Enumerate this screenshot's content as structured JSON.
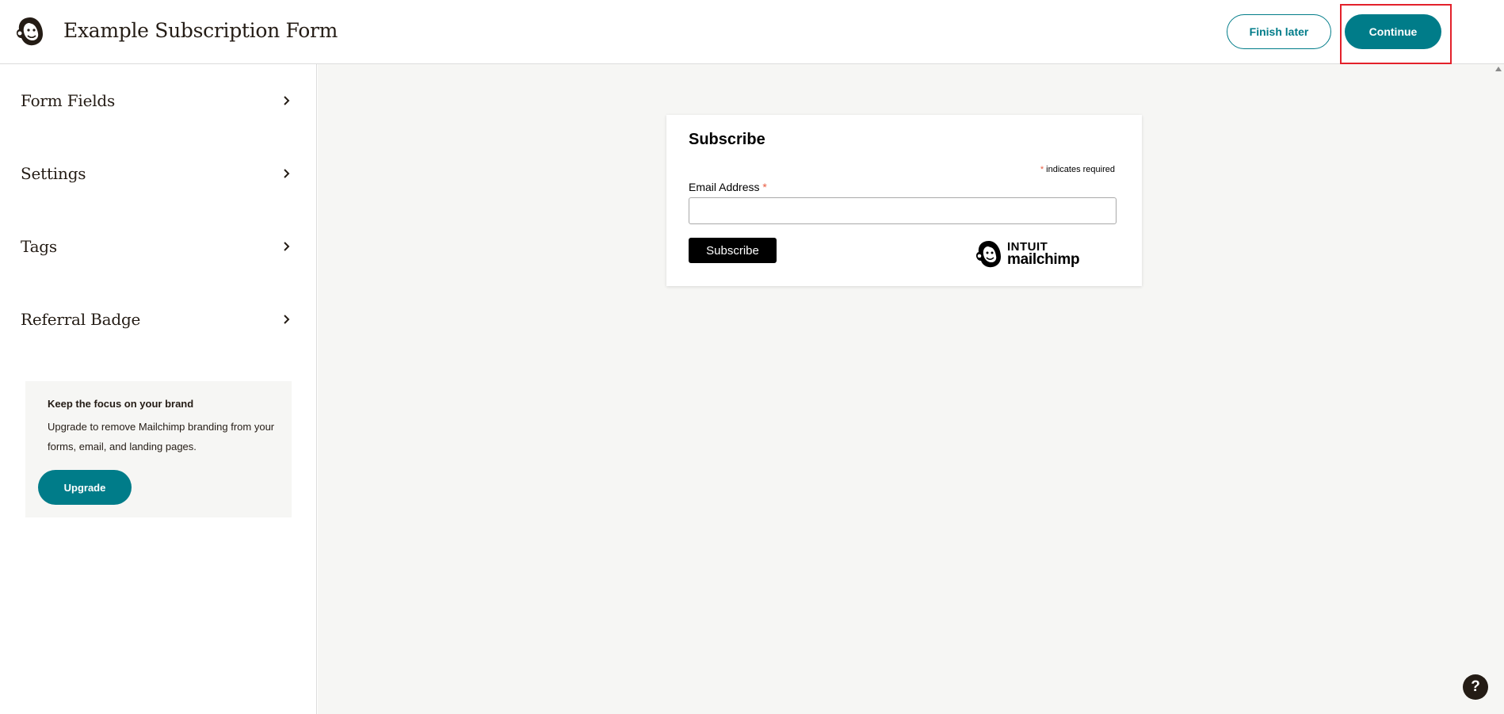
{
  "header": {
    "logo_icon": "mailchimp-freddie-icon",
    "title": "Example Subscription Form",
    "finish_later_label": "Finish later",
    "continue_label": "Continue"
  },
  "sidebar": {
    "items": [
      {
        "label": "Form Fields",
        "icon": "chevron-right-icon"
      },
      {
        "label": "Settings",
        "icon": "chevron-right-icon"
      },
      {
        "label": "Tags",
        "icon": "chevron-right-icon"
      },
      {
        "label": "Referral Badge",
        "icon": "chevron-right-icon"
      }
    ],
    "promo": {
      "title": "Keep the focus on your brand",
      "text": "Upgrade to remove Mailchimp branding from your forms, email, and landing pages.",
      "button_label": "Upgrade"
    }
  },
  "form": {
    "title": "Subscribe",
    "required_star": "*",
    "required_note": " indicates required",
    "email_label": "Email Address ",
    "email_value": "",
    "subscribe_label": "Subscribe",
    "brand_top": "INTUIT",
    "brand_bottom": "mailchimp"
  },
  "help": {
    "label": "?"
  },
  "colors": {
    "accent": "#007c89",
    "highlight": "#e3212b",
    "required": "#e85c41",
    "canvas": "#f6f6f4"
  }
}
